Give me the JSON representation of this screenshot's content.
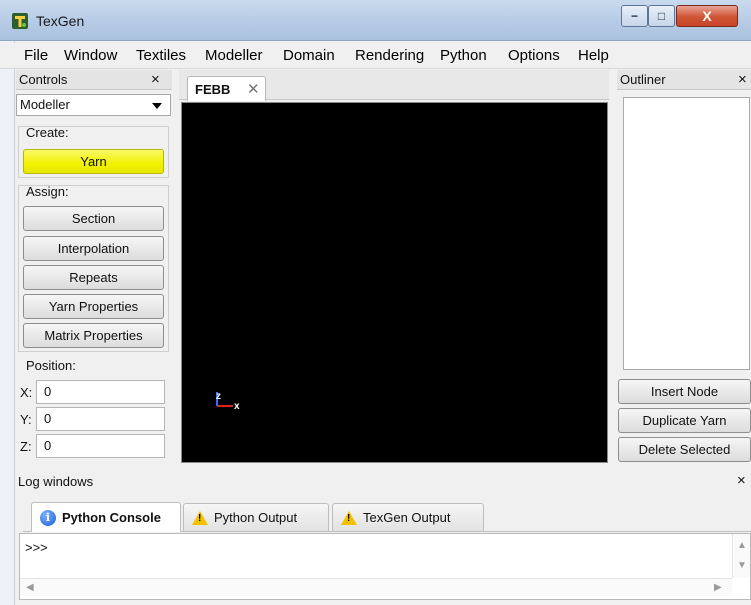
{
  "window": {
    "title": "TexGen",
    "minimize_glyph": "−",
    "maximize_glyph": "□",
    "close_glyph": "X",
    "icon": "texgen-app-icon"
  },
  "menu": [
    "File",
    "Window",
    "Textiles",
    "Modeller",
    "Domain",
    "Rendering",
    "Python",
    "Options",
    "Help"
  ],
  "controls": {
    "title": "Controls",
    "close_glyph": "×",
    "mode": "Modeller",
    "create_label": "Create:",
    "create_buttons": [
      "Yarn"
    ],
    "assign_label": "Assign:",
    "assign_buttons": [
      "Section",
      "Interpolation",
      "Repeats",
      "Yarn Properties",
      "Matrix Properties"
    ],
    "position_label": "Position:",
    "position": [
      {
        "label": "X:",
        "value": "0"
      },
      {
        "label": "Y:",
        "value": "0"
      },
      {
        "label": "Z:",
        "value": "0"
      }
    ],
    "highlight_color": "#f2f200"
  },
  "viewport": {
    "tab_label": "FEBB",
    "tab_close_glyph": "✕",
    "background": "#000000",
    "axes": {
      "z": "z",
      "x": "x"
    }
  },
  "outliner": {
    "title": "Outliner",
    "close_glyph": "×",
    "buttons": [
      "Insert Node",
      "Duplicate Yarn",
      "Delete Selected"
    ]
  },
  "log": {
    "title": "Log windows",
    "close_glyph": "×",
    "tabs": [
      {
        "label": "Python Console",
        "icon": "info-icon",
        "active": true
      },
      {
        "label": "Python Output",
        "icon": "warning-icon",
        "active": false
      },
      {
        "label": "TexGen Output",
        "icon": "warning-icon",
        "active": false
      }
    ],
    "prompt": ">>>",
    "scroll_up": "▲",
    "scroll_down": "▼",
    "scroll_left": "◀",
    "scroll_right": "▶"
  }
}
